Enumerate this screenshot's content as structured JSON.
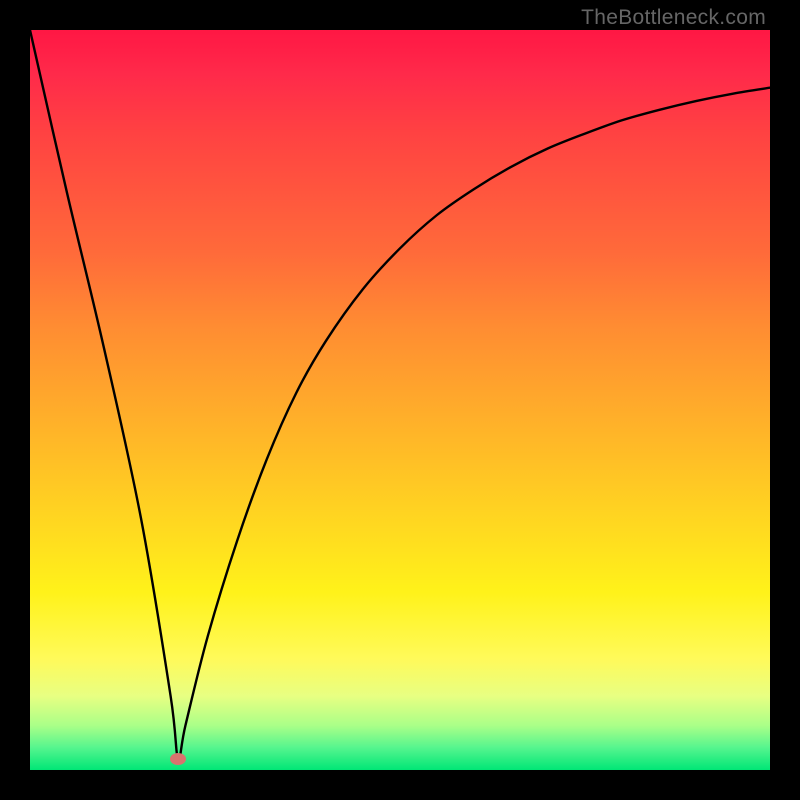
{
  "watermark": "TheBottleneck.com",
  "chart_data": {
    "type": "line",
    "title": "",
    "xlabel": "",
    "ylabel": "",
    "xlim": [
      0,
      100
    ],
    "ylim": [
      0,
      100
    ],
    "series": [
      {
        "name": "curve",
        "x": [
          0,
          5,
          10,
          15,
          19,
          20,
          21,
          24,
          28,
          32,
          36,
          40,
          45,
          50,
          55,
          60,
          65,
          70,
          75,
          80,
          85,
          90,
          95,
          100
        ],
        "y": [
          100,
          78,
          57,
          34,
          10,
          1.5,
          6,
          18,
          31,
          42,
          51,
          58,
          65,
          70.5,
          75,
          78.5,
          81.5,
          84,
          86,
          87.8,
          89.2,
          90.4,
          91.4,
          92.2
        ]
      }
    ],
    "marker": {
      "x": 20,
      "y": 1.5
    },
    "background_gradient": {
      "top": "#ff1744",
      "middle": "#ffd022",
      "bottom": "#00e676"
    }
  }
}
